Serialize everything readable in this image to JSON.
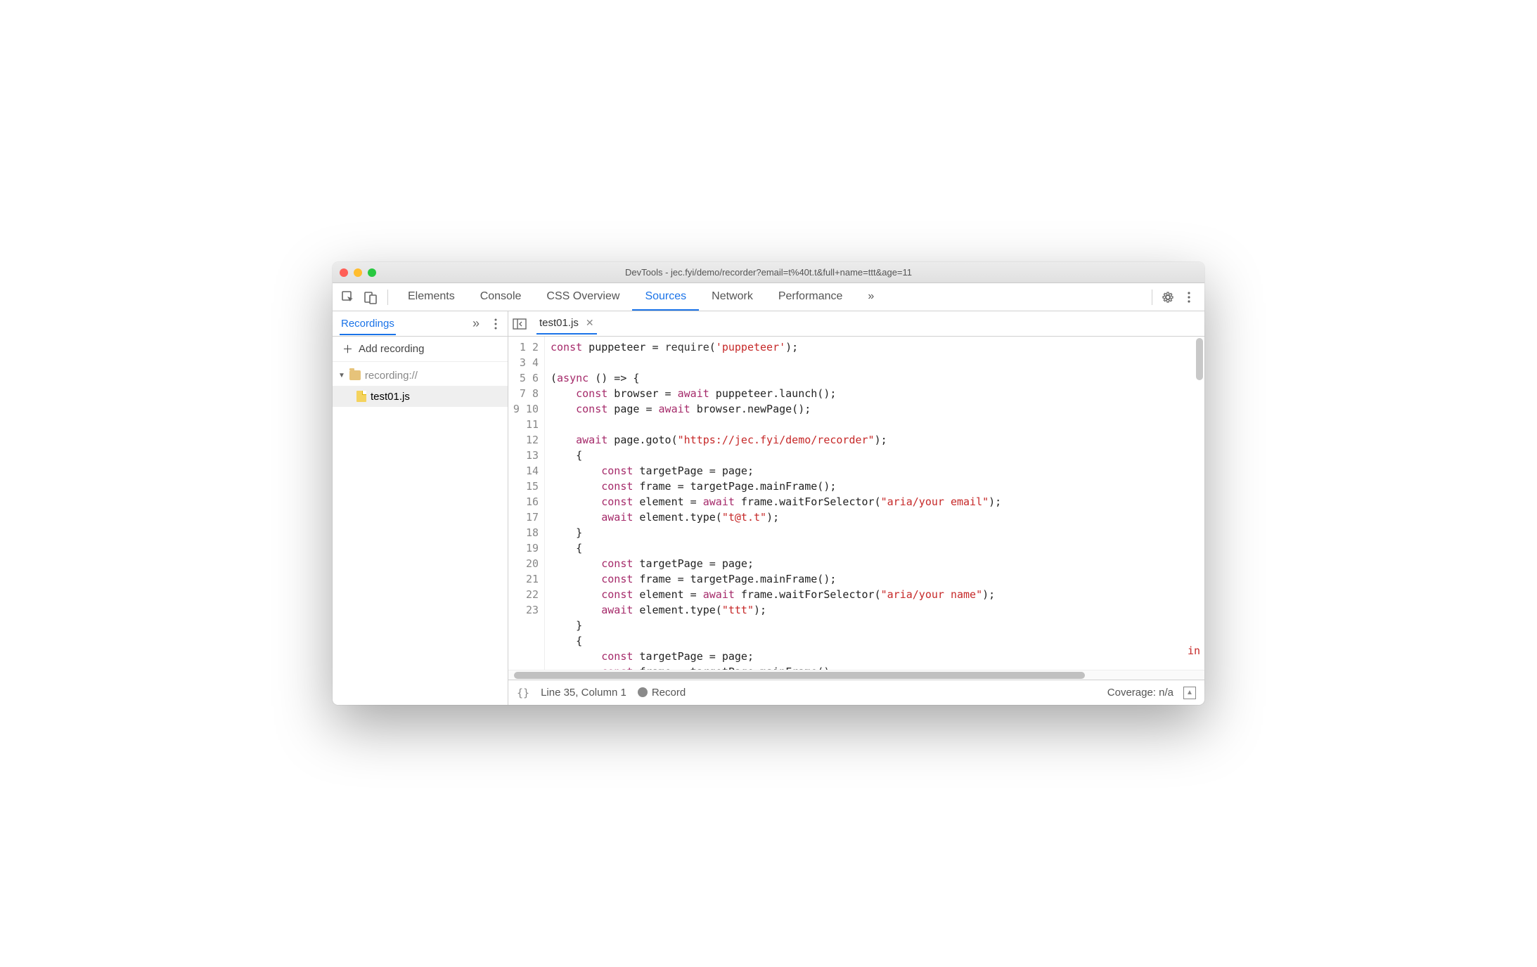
{
  "window": {
    "title": "DevTools - jec.fyi/demo/recorder?email=t%40t.t&full+name=ttt&age=11"
  },
  "toolbar": {
    "tabs": [
      "Elements",
      "Console",
      "CSS Overview",
      "Sources",
      "Network",
      "Performance"
    ],
    "active_tab_index": 3,
    "overflow_glyph": "»"
  },
  "sidebar": {
    "panel_tab": "Recordings",
    "overflow_glyph": "»",
    "add_label": "Add recording",
    "tree": {
      "root_label": "recording://",
      "file": "test01.js"
    }
  },
  "editor": {
    "open_file": "test01.js",
    "code_lines": [
      {
        "n": 1,
        "tokens": [
          [
            "kw",
            "const"
          ],
          [
            "",
            " puppeteer = "
          ],
          [
            "fn",
            "require"
          ],
          [
            "",
            "("
          ],
          [
            "str",
            "'puppeteer'"
          ],
          [
            "",
            ");"
          ]
        ]
      },
      {
        "n": 2,
        "tokens": [
          [
            "",
            ""
          ]
        ]
      },
      {
        "n": 3,
        "tokens": [
          [
            "",
            "("
          ],
          [
            "kw",
            "async"
          ],
          [
            "",
            " () => {"
          ]
        ]
      },
      {
        "n": 4,
        "tokens": [
          [
            "",
            "    "
          ],
          [
            "kw",
            "const"
          ],
          [
            "",
            " browser = "
          ],
          [
            "kw",
            "await"
          ],
          [
            "",
            " puppeteer.launch();"
          ]
        ]
      },
      {
        "n": 5,
        "tokens": [
          [
            "",
            "    "
          ],
          [
            "kw",
            "const"
          ],
          [
            "",
            " page = "
          ],
          [
            "kw",
            "await"
          ],
          [
            "",
            " browser.newPage();"
          ]
        ]
      },
      {
        "n": 6,
        "tokens": [
          [
            "",
            ""
          ]
        ]
      },
      {
        "n": 7,
        "tokens": [
          [
            "",
            "    "
          ],
          [
            "kw",
            "await"
          ],
          [
            "",
            " page.goto("
          ],
          [
            "str",
            "\"https://jec.fyi/demo/recorder\""
          ],
          [
            "",
            ");"
          ]
        ]
      },
      {
        "n": 8,
        "tokens": [
          [
            "",
            "    {"
          ]
        ]
      },
      {
        "n": 9,
        "tokens": [
          [
            "",
            "        "
          ],
          [
            "kw",
            "const"
          ],
          [
            "",
            " targetPage = page;"
          ]
        ]
      },
      {
        "n": 10,
        "tokens": [
          [
            "",
            "        "
          ],
          [
            "kw",
            "const"
          ],
          [
            "",
            " frame = targetPage.mainFrame();"
          ]
        ]
      },
      {
        "n": 11,
        "tokens": [
          [
            "",
            "        "
          ],
          [
            "kw",
            "const"
          ],
          [
            "",
            " element = "
          ],
          [
            "kw",
            "await"
          ],
          [
            "",
            " frame.waitForSelector("
          ],
          [
            "str",
            "\"aria/your email\""
          ],
          [
            "",
            ");"
          ]
        ]
      },
      {
        "n": 12,
        "tokens": [
          [
            "",
            "        "
          ],
          [
            "kw",
            "await"
          ],
          [
            "",
            " element.type("
          ],
          [
            "str",
            "\"t@t.t\""
          ],
          [
            "",
            ");"
          ]
        ]
      },
      {
        "n": 13,
        "tokens": [
          [
            "",
            "    }"
          ]
        ]
      },
      {
        "n": 14,
        "tokens": [
          [
            "",
            "    {"
          ]
        ]
      },
      {
        "n": 15,
        "tokens": [
          [
            "",
            "        "
          ],
          [
            "kw",
            "const"
          ],
          [
            "",
            " targetPage = page;"
          ]
        ]
      },
      {
        "n": 16,
        "tokens": [
          [
            "",
            "        "
          ],
          [
            "kw",
            "const"
          ],
          [
            "",
            " frame = targetPage.mainFrame();"
          ]
        ]
      },
      {
        "n": 17,
        "tokens": [
          [
            "",
            "        "
          ],
          [
            "kw",
            "const"
          ],
          [
            "",
            " element = "
          ],
          [
            "kw",
            "await"
          ],
          [
            "",
            " frame.waitForSelector("
          ],
          [
            "str",
            "\"aria/your name\""
          ],
          [
            "",
            ");"
          ]
        ]
      },
      {
        "n": 18,
        "tokens": [
          [
            "",
            "        "
          ],
          [
            "kw",
            "await"
          ],
          [
            "",
            " element.type("
          ],
          [
            "str",
            "\"ttt\""
          ],
          [
            "",
            ");"
          ]
        ]
      },
      {
        "n": 19,
        "tokens": [
          [
            "",
            "    }"
          ]
        ]
      },
      {
        "n": 20,
        "tokens": [
          [
            "",
            "    {"
          ]
        ]
      },
      {
        "n": 21,
        "tokens": [
          [
            "",
            "        "
          ],
          [
            "kw",
            "const"
          ],
          [
            "",
            " targetPage = page;"
          ]
        ]
      },
      {
        "n": 22,
        "tokens": [
          [
            "",
            "        "
          ],
          [
            "kw",
            "const"
          ],
          [
            "",
            " frame = targetPage.mainFrame();"
          ]
        ]
      },
      {
        "n": 23,
        "tokens": [
          [
            "",
            ""
          ]
        ]
      }
    ],
    "truncated_hint": "in"
  },
  "status": {
    "braces": "{}",
    "cursor": "Line 35, Column 1",
    "record_label": "Record",
    "coverage": "Coverage: n/a",
    "collapse_glyph": "▲"
  }
}
